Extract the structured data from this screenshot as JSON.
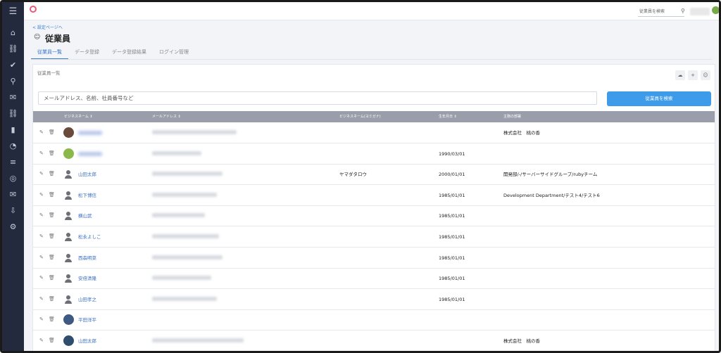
{
  "sidebar": {
    "items": [
      {
        "icon": "menu-icon"
      },
      {
        "icon": "home-icon"
      },
      {
        "icon": "org-chart-icon"
      },
      {
        "icon": "user-check-icon"
      },
      {
        "icon": "search-icon"
      },
      {
        "icon": "chat-icon"
      },
      {
        "icon": "link-icon"
      },
      {
        "icon": "bar-chart-icon"
      },
      {
        "icon": "dashboard-icon"
      },
      {
        "icon": "list-icon"
      },
      {
        "icon": "target-icon"
      },
      {
        "icon": "mail-icon"
      },
      {
        "icon": "download-icon"
      },
      {
        "icon": "gear-icon"
      }
    ]
  },
  "header": {
    "search_placeholder": "従業員を検索"
  },
  "page": {
    "back_link": "< 設定ページへ",
    "title": "従業員"
  },
  "tabs": [
    {
      "label": "従業員一覧",
      "active": true
    },
    {
      "label": "データ登録",
      "active": false
    },
    {
      "label": "データ登録結果",
      "active": false
    },
    {
      "label": "ログイン管理",
      "active": false
    }
  ],
  "card": {
    "title": "従業員一覧",
    "search_placeholder": "メールアドレス、名前、社員番号など",
    "search_button": "従業員を検索"
  },
  "table": {
    "headers": [
      "ビジネスネーム ⇕",
      "メールアドレス ⇕",
      "ビジネスネーム(ヨミガナ)",
      "生年月日 ⇕",
      "主務の部署"
    ],
    "rows": [
      {
        "avatar": "photo1",
        "name": "",
        "blur_name": true,
        "email_w": 120,
        "kana": "",
        "birthday": "",
        "dept": "株式会社　桃の香"
      },
      {
        "avatar": "photo2",
        "name": "",
        "blur_name": true,
        "email_w": 70,
        "kana": "",
        "birthday": "1990/03/01",
        "dept": ""
      },
      {
        "avatar": "gen",
        "name": "山田太郎",
        "blur_name": false,
        "email_w": 100,
        "kana": "ヤマダタロウ",
        "birthday": "2000/01/01",
        "dept": "開発部/-/サーバーサイドグループ/rubyチーム"
      },
      {
        "avatar": "gen",
        "name": "松下博信",
        "blur_name": false,
        "email_w": 92,
        "kana": "",
        "birthday": "1985/01/01",
        "dept": "Development Department/テスト4/テスト6"
      },
      {
        "avatar": "gen",
        "name": "横山武",
        "blur_name": false,
        "email_w": 75,
        "kana": "",
        "birthday": "1985/01/01",
        "dept": ""
      },
      {
        "avatar": "gen",
        "name": "松永よしこ",
        "blur_name": false,
        "email_w": 95,
        "kana": "",
        "birthday": "1985/01/01",
        "dept": ""
      },
      {
        "avatar": "gen",
        "name": "西森明菜",
        "blur_name": false,
        "email_w": 100,
        "kana": "",
        "birthday": "1985/01/01",
        "dept": ""
      },
      {
        "avatar": "gen",
        "name": "安倍清隆",
        "blur_name": false,
        "email_w": 84,
        "kana": "",
        "birthday": "1985/01/01",
        "dept": ""
      },
      {
        "avatar": "gen",
        "name": "山田孝之",
        "blur_name": false,
        "email_w": 92,
        "kana": "",
        "birthday": "1985/01/01",
        "dept": ""
      },
      {
        "avatar": "photo3",
        "name": "平田洋平",
        "blur_name": false,
        "email_w": 0,
        "kana": "",
        "birthday": "",
        "dept": ""
      },
      {
        "avatar": "photo4",
        "name": "山田太郎",
        "blur_name": false,
        "email_w": 130,
        "kana": "",
        "birthday": "",
        "dept": "株式会社　桃の香"
      }
    ]
  }
}
